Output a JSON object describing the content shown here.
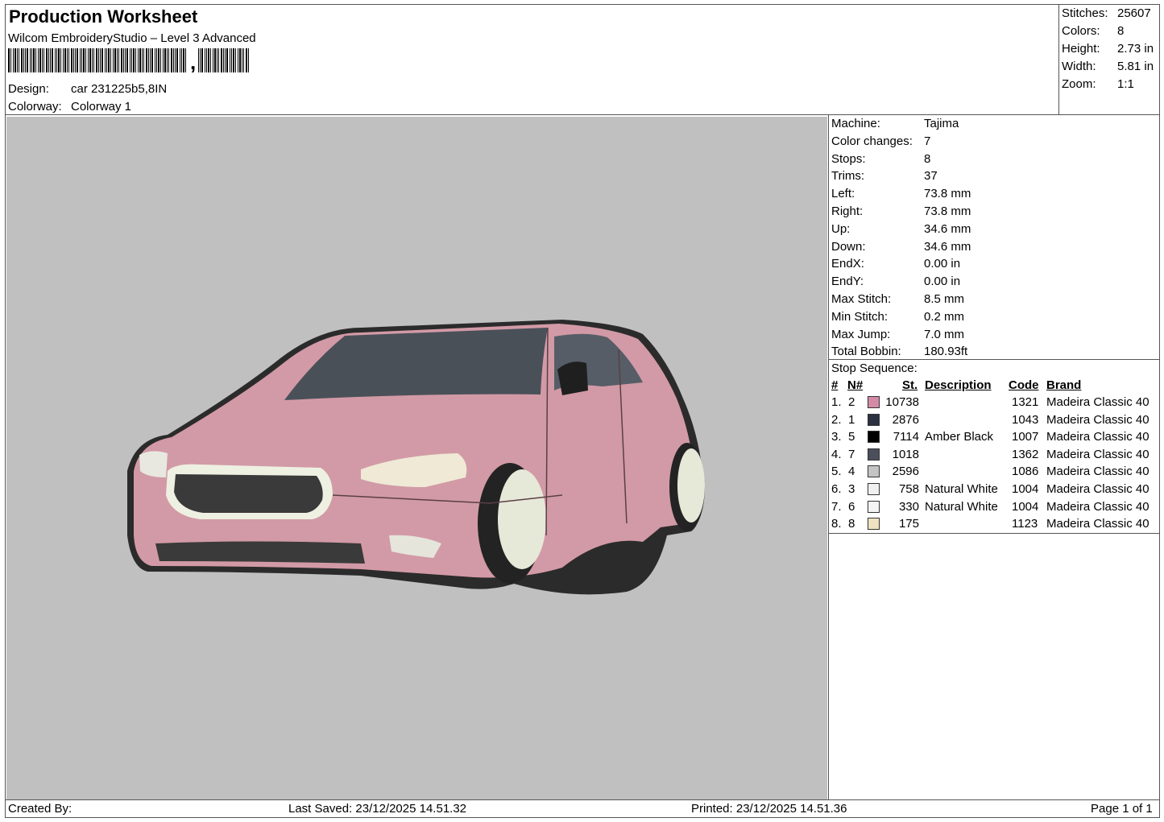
{
  "header": {
    "title": "Production Worksheet",
    "software": "Wilcom EmbroideryStudio – Level 3 Advanced",
    "barcode_suffix": ",",
    "design_label": "Design:",
    "design_value": "car 231225b5,8IN",
    "colorway_label": "Colorway:",
    "colorway_value": "Colorway 1"
  },
  "summary": [
    {
      "label": "Stitches:",
      "value": "25607"
    },
    {
      "label": "Colors:",
      "value": "8"
    },
    {
      "label": "Height:",
      "value": "2.73 in"
    },
    {
      "label": "Width:",
      "value": "5.81 in"
    },
    {
      "label": "Zoom:",
      "value": "1:1"
    }
  ],
  "machine_info": [
    {
      "label": "Machine:",
      "value": "Tajima"
    },
    {
      "label": "Color changes:",
      "value": "7"
    },
    {
      "label": "Stops:",
      "value": "8"
    },
    {
      "label": "Trims:",
      "value": "37"
    },
    {
      "label": "Left:",
      "value": "73.8 mm"
    },
    {
      "label": "Right:",
      "value": "73.8 mm"
    },
    {
      "label": "Up:",
      "value": "34.6 mm"
    },
    {
      "label": "Down:",
      "value": "34.6 mm"
    },
    {
      "label": "EndX:",
      "value": "0.00 in"
    },
    {
      "label": "EndY:",
      "value": "0.00 in"
    },
    {
      "label": "Max Stitch:",
      "value": "8.5 mm"
    },
    {
      "label": "Min Stitch:",
      "value": "0.2 mm"
    },
    {
      "label": "Max Jump:",
      "value": "7.0 mm"
    },
    {
      "label": "Total Bobbin:",
      "value": "180.93ft"
    }
  ],
  "stop_sequence": {
    "title": "Stop Sequence:",
    "columns": {
      "num": "#",
      "n": "N#",
      "st": "St.",
      "desc": "Description",
      "code": "Code",
      "brand": "Brand"
    },
    "rows": [
      {
        "num": "1.",
        "n": "2",
        "color": "#d48aa6",
        "st": "10738",
        "desc": "",
        "code": "1321",
        "brand": "Madeira Classic 40"
      },
      {
        "num": "2.",
        "n": "1",
        "color": "#2a3140",
        "st": "2876",
        "desc": "",
        "code": "1043",
        "brand": "Madeira Classic 40"
      },
      {
        "num": "3.",
        "n": "5",
        "color": "#000000",
        "st": "7114",
        "desc": "Amber Black",
        "code": "1007",
        "brand": "Madeira Classic 40"
      },
      {
        "num": "4.",
        "n": "7",
        "color": "#4b4f5c",
        "st": "1018",
        "desc": "",
        "code": "1362",
        "brand": "Madeira Classic 40"
      },
      {
        "num": "5.",
        "n": "4",
        "color": "#c4c4c4",
        "st": "2596",
        "desc": "",
        "code": "1086",
        "brand": "Madeira Classic 40"
      },
      {
        "num": "6.",
        "n": "3",
        "color": "#f0f0f0",
        "st": "758",
        "desc": "Natural White",
        "code": "1004",
        "brand": "Madeira Classic 40"
      },
      {
        "num": "7.",
        "n": "6",
        "color": "#f4f4f4",
        "st": "330",
        "desc": "Natural White",
        "code": "1004",
        "brand": "Madeira Classic 40"
      },
      {
        "num": "8.",
        "n": "8",
        "color": "#efe3c2",
        "st": "175",
        "desc": "",
        "code": "1123",
        "brand": "Madeira Classic 40"
      }
    ]
  },
  "footer": {
    "created_by": "Created By:",
    "last_saved": "Last Saved: 23/12/2025 14.51.32",
    "printed": "Printed: 23/12/2025 14.51.36",
    "page": "Page 1 of 1"
  },
  "colors": {
    "canvas": "#c0c0c0",
    "car_body": "#d29aa6",
    "window": "#4a5058",
    "trim": "#262626",
    "wheel": "#e6e8d8"
  }
}
